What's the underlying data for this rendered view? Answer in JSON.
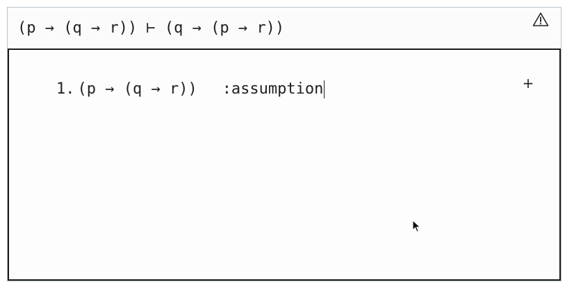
{
  "header": {
    "goal": "(p → (q → r)) ⊢ (q → (p → r))",
    "warning_icon": "warning-triangle-icon"
  },
  "proof": {
    "lines": [
      {
        "number": "1.",
        "formula": "(p → (q → r))",
        "justification": ":assumption"
      }
    ],
    "add_label": "+"
  },
  "colors": {
    "border": "#1a1a1a",
    "outer_border": "#b8c4cc",
    "text": "#222222"
  }
}
